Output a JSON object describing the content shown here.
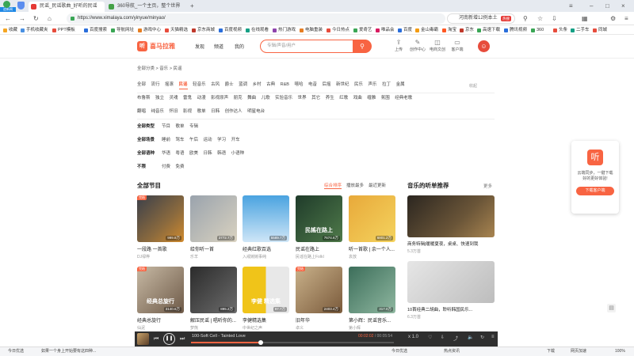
{
  "browser": {
    "badge": "追新闻",
    "tabs": [
      {
        "label": "民谣_民谣歌曲_好听的民谣",
        "active": true,
        "color": "#e53935"
      },
      {
        "label": "360导航_一个主页，整个世界",
        "active": false,
        "color": "#43a047"
      }
    ],
    "url": "https://www.ximalaya.com/yinyue/minyao/",
    "url_prefix": "https://",
    "search_box": "河南新增12例本土",
    "search_badge": "热搜",
    "bookmarks": [
      {
        "label": "收藏",
        "color": "#f5a623"
      },
      {
        "label": "手机收藏夹",
        "color": "#4a90e2"
      },
      {
        "label": "PPT模板",
        "color": "#e74c3c"
      },
      {
        "label": "百度搜索",
        "color": "#2a6edb"
      },
      {
        "label": "导航网址",
        "color": "#3aa655"
      },
      {
        "label": "游戏中心",
        "color": "#e67e22"
      },
      {
        "label": "天猫精选",
        "color": "#e74c3c"
      },
      {
        "label": "京东商城",
        "color": "#c0392b"
      },
      {
        "label": "百度视频",
        "color": "#2a6edb"
      },
      {
        "label": "在线观看",
        "color": "#16a085"
      },
      {
        "label": "热门游戏",
        "color": "#8e44ad"
      },
      {
        "label": "电脑重装",
        "color": "#e67e22"
      },
      {
        "label": "今日热点",
        "color": "#e74c3c"
      },
      {
        "label": "爱奇艺",
        "color": "#3aa655"
      },
      {
        "label": "唯品会",
        "color": "#d81b60"
      },
      {
        "label": "百度",
        "color": "#2a6edb"
      },
      {
        "label": "金山毒霸",
        "color": "#f39c12"
      },
      {
        "label": "淘宝",
        "color": "#ff5722"
      },
      {
        "label": "京东",
        "color": "#c0392b"
      },
      {
        "label": "高速下载",
        "color": "#3aa655"
      },
      {
        "label": "腾讯视频",
        "color": "#2a6edb"
      },
      {
        "label": "360",
        "color": "#3aa655"
      },
      {
        "label": "头条",
        "color": "#e74c3c"
      },
      {
        "label": "二手车",
        "color": "#16a085"
      },
      {
        "label": "同城",
        "color": "#e74c3c"
      }
    ]
  },
  "site": {
    "logo": "喜马拉雅",
    "logo_mark": "听",
    "nav": [
      "发现",
      "频道",
      "我的"
    ],
    "search_placeholder": "专辑/声音/用户",
    "header_icons": [
      {
        "label": "上传",
        "glyph": "⇪"
      },
      {
        "label": "创作中心",
        "glyph": "✎"
      },
      {
        "label": "电商文创",
        "glyph": "◫"
      },
      {
        "label": "客户端",
        "glyph": "▭"
      }
    ]
  },
  "breadcrumb": [
    "全部分类",
    "音乐",
    "民谣"
  ],
  "filters": {
    "row1": [
      "全部",
      "流行",
      "摇滚",
      "民谣",
      "轻音乐",
      "古风",
      "爵士",
      "蓝调",
      "乡村",
      "古典",
      "R&B",
      "嘻哈",
      "电音",
      "后摇",
      "新世纪",
      "民乐",
      "声乐",
      "拉丁",
      "金属"
    ],
    "row1_selected": "民谣",
    "collapse": "收起",
    "row2": [
      "布鲁斯",
      "独立",
      "灵魂",
      "雷鬼",
      "动漫",
      "影视原声",
      "朋克",
      "舞曲",
      "儿歌",
      "实验音乐",
      "世界",
      "其它",
      "养生",
      "红歌",
      "戏曲",
      "缠雅",
      "氛围",
      "经典老歌"
    ],
    "row3": [
      "翻唱",
      "纯音乐",
      "怀旧",
      "影视",
      "歌单",
      "日韩",
      "创作达人",
      "明星电台"
    ],
    "labeled": [
      {
        "label": "全部类型",
        "items": [
          "节目",
          "歌单",
          "专辑"
        ]
      },
      {
        "label": "全部场景",
        "items": [
          "睡前",
          "驾车",
          "午后",
          "运动",
          "学习",
          "开车"
        ]
      },
      {
        "label": "全部语种",
        "items": [
          "华语",
          "粤语",
          "欧美",
          "日韩",
          "韩语",
          "小语种"
        ]
      },
      {
        "label": "不限",
        "items": [
          "付费",
          "免费"
        ]
      }
    ]
  },
  "programs": {
    "title": "全部节目",
    "sort": [
      "综合排序",
      "播放最多",
      "最近更新"
    ],
    "sort_selected": "综合排序",
    "cards": [
      {
        "title": "一段路 一首歌",
        "author": "DJ禄桦",
        "plays": "999.8万",
        "tag": "完结",
        "bg": "linear-gradient(135deg,#3a3f4a,#8b6a3e 60%,#d08a2e)",
        "cover_text": ""
      },
      {
        "title": "给你听一首",
        "author": "乐羊",
        "plays": "3772.7万",
        "tag": "",
        "bg": "linear-gradient(135deg,#9aa3ad,#d9d2c0)",
        "cover_text": ""
      },
      {
        "title": "经典红歌百选",
        "author": "入戒婉婉事纯",
        "plays": "5589.7万",
        "tag": "",
        "bg": "linear-gradient(180deg,#4aa3e0,#cfe6f7)",
        "cover_text": ""
      },
      {
        "title": "民谣在路上",
        "author": "民谣在路上FolkI",
        "plays": "7674.6万",
        "tag": "",
        "bg": "linear-gradient(135deg,#1f3b2a,#4f7a4a)",
        "cover_text": "民謠在路上"
      },
      {
        "title": "听一首歌 | 余一个人...",
        "author": "袁放",
        "plays": "6801.2万",
        "tag": "",
        "bg": "linear-gradient(135deg,#e8a93a,#f4d35e)",
        "cover_text": ""
      },
      {
        "title": "经典总旋行",
        "author": "仙泥",
        "plays": "3140.6万",
        "tag": "完结",
        "bg": "linear-gradient(135deg,#c7b9a4,#6e5a48)",
        "cover_text": "经典总旋行"
      },
      {
        "title": "解压民谣 | 唱听你的...",
        "author": "梦熊",
        "plays": "895.2万",
        "tag": "",
        "bg": "linear-gradient(135deg,#2b2b2b,#6c6c6c)",
        "cover_text": ""
      },
      {
        "title": "李健精选集",
        "author": "中世纪之声",
        "plays": "97.7万",
        "tag": "",
        "bg": "linear-gradient(90deg,#f0c419 50%,#e8e8e8 50%)",
        "cover_text": "李健 精选集"
      },
      {
        "title": "旧年华",
        "author": "卓义",
        "plays": "2403.4万",
        "tag": "完结",
        "bg": "linear-gradient(135deg,#c9b18a,#7a5a3b)",
        "cover_text": ""
      },
      {
        "title": "第小辉：民谣音乐...",
        "author": "第小辉",
        "plays": "317.0万",
        "tag": "",
        "bg": "linear-gradient(135deg,#3c6e5a,#8fb7a0)",
        "cover_text": ""
      }
    ]
  },
  "recommend": {
    "title": "音乐的听单推荐",
    "more": "更多",
    "items": [
      {
        "title": "商务特辑|暖暖夏夜，桌桌、快速到我",
        "author": "5.3万首",
        "bg": "linear-gradient(135deg,#2b2620,#6a5538 60%,#a88450)"
      },
      {
        "title": "10首经典二胡曲，聆听韩国民乐...",
        "author": "6.3万首",
        "bg": "linear-gradient(135deg,#e6e6e6,#bdbdbd)"
      }
    ]
  },
  "promo": {
    "text": "云端同步，一键下载好的更好体验!",
    "button": "下载客户端",
    "glyph": "听"
  },
  "player": {
    "title": "100-Soft Cell - Tainted Love",
    "elapsed": "00:02:02",
    "total": "00:05:54",
    "progress": 0.345,
    "speed": "x 1.0"
  },
  "statusbar": {
    "left": "今日优选",
    "news": "如果一个身上开始要有这四种...",
    "items": [
      "今日优选",
      "热点资讯",
      "下载",
      "网页加速",
      "100%"
    ]
  }
}
